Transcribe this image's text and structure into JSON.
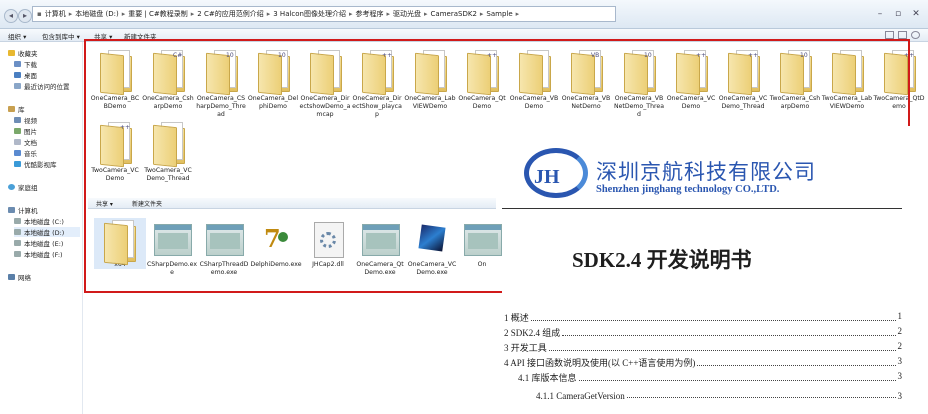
{
  "address_bar": {
    "crumbs": [
      "计算机",
      "本地磁盘 (D:)",
      "重要 | C#教程录制",
      "2 C#的应用范例介绍",
      "3 Halcon图像处理介绍",
      "参考程序",
      "驱动光盘",
      "CameraSDK2",
      "Sample"
    ]
  },
  "toolbar": {
    "organize": "组织 ▾",
    "include": "包含到库中 ▾",
    "share": "共享 ▾",
    "new_folder": "新建文件夹"
  },
  "sidebar": {
    "favorites": "收藏夹",
    "downloads": "下载",
    "desktop": "桌面",
    "recent": "最近访问的位置",
    "libraries": "库",
    "videos": "视频",
    "pictures": "图片",
    "documents": "文档",
    "music": "音乐",
    "youku": "优酷影视库",
    "homegroup": "家庭组",
    "computer": "计算机",
    "drive_c": "本地磁盘 (C:)",
    "drive_d": "本地磁盘 (D:)",
    "drive_e": "本地磁盘 (E:)",
    "drive_f": "本地磁盘 (F:)",
    "network": "网络"
  },
  "folders": [
    {
      "label": "OneCamera_BCBDemo",
      "badge": ""
    },
    {
      "label": "OneCamera_CsharpDemo",
      "badge": "C#"
    },
    {
      "label": "OneCamera_CSharpDemo_Thread",
      "badge": "10"
    },
    {
      "label": "OneCamera_DelphiDemo",
      "badge": "10"
    },
    {
      "label": "OneCamera_DirectshowDemo_amcap",
      "badge": ""
    },
    {
      "label": "OneCamera_DirectShow_playcap",
      "badge": "++"
    },
    {
      "label": "OneCamera_LabVIEWDemo",
      "badge": ""
    },
    {
      "label": "OneCamera_QtDemo",
      "badge": "++"
    },
    {
      "label": "OneCamera_VBDemo",
      "badge": ""
    },
    {
      "label": "OneCamera_VBNetDemo",
      "badge": "VB"
    },
    {
      "label": "OneCamera_VBNetDemo_Thread",
      "badge": "10"
    },
    {
      "label": "OneCamera_VCDemo",
      "badge": "++"
    },
    {
      "label": "OneCamera_VCDemo_Thread",
      "badge": "++"
    },
    {
      "label": "TwoCamera_CsharpDemo",
      "badge": "10"
    },
    {
      "label": "TwoCamera_LabVIEWDemo",
      "badge": ""
    },
    {
      "label": "TwoCamera_QtDemo",
      "badge": "++"
    },
    {
      "label": "TwoCamera_VCDemo",
      "badge": "++"
    },
    {
      "label": "TwoCamera_VCDemo_Thread",
      "badge": ""
    }
  ],
  "sub_toolbar": {
    "share": "共享 ▾",
    "new_folder": "新建文件夹"
  },
  "files": [
    {
      "label": "x64",
      "kind": "folder"
    },
    {
      "label": "CSharpDemo.exe",
      "kind": "window"
    },
    {
      "label": "CSharpThreadDemo.exe",
      "kind": "window"
    },
    {
      "label": "DelphiDemo.exe",
      "kind": "delphi"
    },
    {
      "label": "JHCap2.dll",
      "kind": "gear"
    },
    {
      "label": "OneCamera_QtDemo.exe",
      "kind": "window"
    },
    {
      "label": "OneCamera_VCDemo.exe",
      "kind": "cube"
    },
    {
      "label": "On",
      "kind": "window"
    }
  ],
  "document": {
    "logo": "JH",
    "company_cn": "深圳京航科技有限公司",
    "company_en": "Shenzhen jinghang technology CO.,LTD.",
    "title": "SDK2.4 开发说明书",
    "toc": [
      {
        "text": "1 概述",
        "page": "1"
      },
      {
        "text": "2 SDK2.4 组成",
        "page": "2"
      },
      {
        "text": "3 开发工具",
        "page": "2"
      },
      {
        "text": "4 API 接口函数说明及使用(以 C++语言使用为例)",
        "page": "3"
      },
      {
        "text": "4.1 库版本信息",
        "page": "3"
      },
      {
        "text": "4.1.1 CameraGetVersion",
        "page": "3"
      }
    ]
  }
}
